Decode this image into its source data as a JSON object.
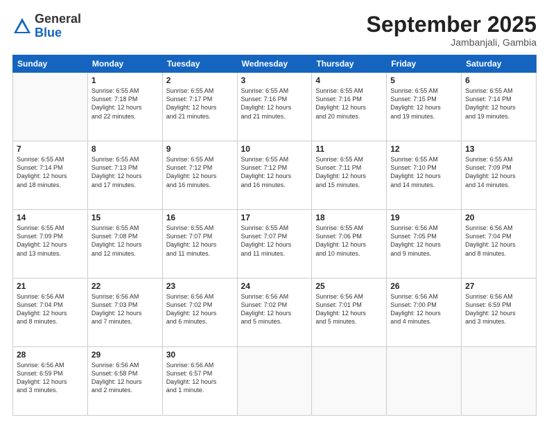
{
  "logo": {
    "general": "General",
    "blue": "Blue"
  },
  "header": {
    "month": "September 2025",
    "location": "Jambanjali, Gambia"
  },
  "weekdays": [
    "Sunday",
    "Monday",
    "Tuesday",
    "Wednesday",
    "Thursday",
    "Friday",
    "Saturday"
  ],
  "weeks": [
    [
      {
        "day": "",
        "info": ""
      },
      {
        "day": "1",
        "info": "Sunrise: 6:55 AM\nSunset: 7:18 PM\nDaylight: 12 hours\nand 22 minutes."
      },
      {
        "day": "2",
        "info": "Sunrise: 6:55 AM\nSunset: 7:17 PM\nDaylight: 12 hours\nand 21 minutes."
      },
      {
        "day": "3",
        "info": "Sunrise: 6:55 AM\nSunset: 7:16 PM\nDaylight: 12 hours\nand 21 minutes."
      },
      {
        "day": "4",
        "info": "Sunrise: 6:55 AM\nSunset: 7:16 PM\nDaylight: 12 hours\nand 20 minutes."
      },
      {
        "day": "5",
        "info": "Sunrise: 6:55 AM\nSunset: 7:15 PM\nDaylight: 12 hours\nand 19 minutes."
      },
      {
        "day": "6",
        "info": "Sunrise: 6:55 AM\nSunset: 7:14 PM\nDaylight: 12 hours\nand 19 minutes."
      }
    ],
    [
      {
        "day": "7",
        "info": "Sunrise: 6:55 AM\nSunset: 7:14 PM\nDaylight: 12 hours\nand 18 minutes."
      },
      {
        "day": "8",
        "info": "Sunrise: 6:55 AM\nSunset: 7:13 PM\nDaylight: 12 hours\nand 17 minutes."
      },
      {
        "day": "9",
        "info": "Sunrise: 6:55 AM\nSunset: 7:12 PM\nDaylight: 12 hours\nand 16 minutes."
      },
      {
        "day": "10",
        "info": "Sunrise: 6:55 AM\nSunset: 7:12 PM\nDaylight: 12 hours\nand 16 minutes."
      },
      {
        "day": "11",
        "info": "Sunrise: 6:55 AM\nSunset: 7:11 PM\nDaylight: 12 hours\nand 15 minutes."
      },
      {
        "day": "12",
        "info": "Sunrise: 6:55 AM\nSunset: 7:10 PM\nDaylight: 12 hours\nand 14 minutes."
      },
      {
        "day": "13",
        "info": "Sunrise: 6:55 AM\nSunset: 7:09 PM\nDaylight: 12 hours\nand 14 minutes."
      }
    ],
    [
      {
        "day": "14",
        "info": "Sunrise: 6:55 AM\nSunset: 7:09 PM\nDaylight: 12 hours\nand 13 minutes."
      },
      {
        "day": "15",
        "info": "Sunrise: 6:55 AM\nSunset: 7:08 PM\nDaylight: 12 hours\nand 12 minutes."
      },
      {
        "day": "16",
        "info": "Sunrise: 6:55 AM\nSunset: 7:07 PM\nDaylight: 12 hours\nand 11 minutes."
      },
      {
        "day": "17",
        "info": "Sunrise: 6:55 AM\nSunset: 7:07 PM\nDaylight: 12 hours\nand 11 minutes."
      },
      {
        "day": "18",
        "info": "Sunrise: 6:55 AM\nSunset: 7:06 PM\nDaylight: 12 hours\nand 10 minutes."
      },
      {
        "day": "19",
        "info": "Sunrise: 6:56 AM\nSunset: 7:05 PM\nDaylight: 12 hours\nand 9 minutes."
      },
      {
        "day": "20",
        "info": "Sunrise: 6:56 AM\nSunset: 7:04 PM\nDaylight: 12 hours\nand 8 minutes."
      }
    ],
    [
      {
        "day": "21",
        "info": "Sunrise: 6:56 AM\nSunset: 7:04 PM\nDaylight: 12 hours\nand 8 minutes."
      },
      {
        "day": "22",
        "info": "Sunrise: 6:56 AM\nSunset: 7:03 PM\nDaylight: 12 hours\nand 7 minutes."
      },
      {
        "day": "23",
        "info": "Sunrise: 6:56 AM\nSunset: 7:02 PM\nDaylight: 12 hours\nand 6 minutes."
      },
      {
        "day": "24",
        "info": "Sunrise: 6:56 AM\nSunset: 7:02 PM\nDaylight: 12 hours\nand 5 minutes."
      },
      {
        "day": "25",
        "info": "Sunrise: 6:56 AM\nSunset: 7:01 PM\nDaylight: 12 hours\nand 5 minutes."
      },
      {
        "day": "26",
        "info": "Sunrise: 6:56 AM\nSunset: 7:00 PM\nDaylight: 12 hours\nand 4 minutes."
      },
      {
        "day": "27",
        "info": "Sunrise: 6:56 AM\nSunset: 6:59 PM\nDaylight: 12 hours\nand 3 minutes."
      }
    ],
    [
      {
        "day": "28",
        "info": "Sunrise: 6:56 AM\nSunset: 6:59 PM\nDaylight: 12 hours\nand 3 minutes."
      },
      {
        "day": "29",
        "info": "Sunrise: 6:56 AM\nSunset: 6:58 PM\nDaylight: 12 hours\nand 2 minutes."
      },
      {
        "day": "30",
        "info": "Sunrise: 6:56 AM\nSunset: 6:57 PM\nDaylight: 12 hours\nand 1 minute."
      },
      {
        "day": "",
        "info": ""
      },
      {
        "day": "",
        "info": ""
      },
      {
        "day": "",
        "info": ""
      },
      {
        "day": "",
        "info": ""
      }
    ]
  ]
}
